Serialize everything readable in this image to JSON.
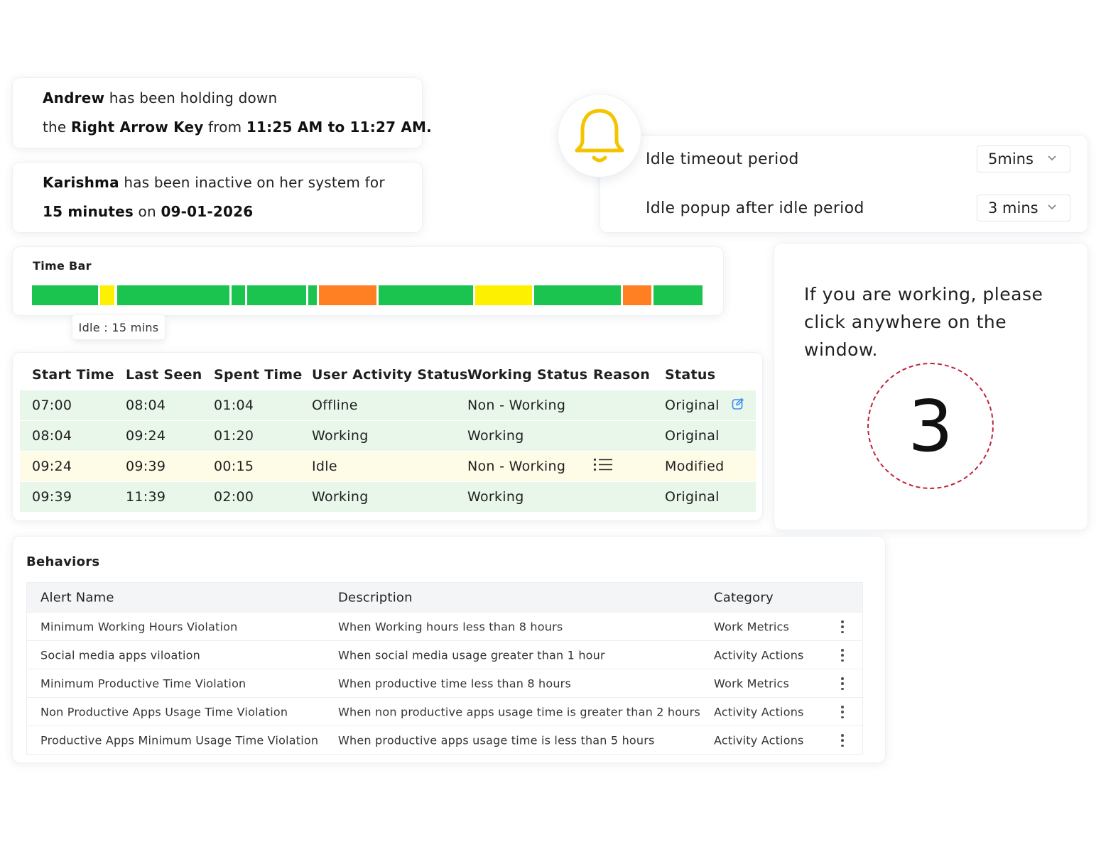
{
  "notifications": {
    "andrew": {
      "name": "Andrew",
      "text1": " has been holding down",
      "text2": "the ",
      "key": "Right Arrow Key",
      "text3": " from ",
      "time_range": "11:25 AM to 11:27 AM."
    },
    "karishma": {
      "name": "Karishma",
      "text1": " has been inactive on her system for",
      "duration": "15 minutes",
      "text2": " on ",
      "date": "09-01-2026"
    }
  },
  "idle_settings": {
    "icon": "bell-icon",
    "bell_color": "#f5c400",
    "timeout_label": "Idle timeout period",
    "timeout_value": "5mins",
    "popup_label": "Idle popup after idle period",
    "popup_value": "3 mins"
  },
  "time_bar": {
    "title": "Time Bar",
    "tooltip": "Idle : 15 mins",
    "colors": {
      "working": "#1ac44e",
      "idle": "#fdf000",
      "offline": "#ff8022"
    },
    "segments": [
      {
        "status": "working",
        "share": 9.4
      },
      {
        "status": "idle",
        "share": 2.1
      },
      {
        "status": "working",
        "share": 16.1
      },
      {
        "status": "working",
        "share": 1.9
      },
      {
        "status": "working",
        "share": 8.4
      },
      {
        "status": "working",
        "share": 1.2
      },
      {
        "status": "offline",
        "share": 8.2
      },
      {
        "status": "working",
        "share": 13.5
      },
      {
        "status": "idle",
        "share": 8.1
      },
      {
        "status": "working",
        "share": 12.4
      },
      {
        "status": "offline",
        "share": 4.0
      },
      {
        "status": "working",
        "share": 7.0
      }
    ]
  },
  "activity_table": {
    "headers": [
      "Start Time",
      "Last Seen",
      "Spent Time",
      "User Activity Status",
      "Working Status",
      "Reason",
      "Status"
    ],
    "rows": [
      {
        "start": "07:00",
        "last": "08:04",
        "spent": "01:04",
        "activity": "Offline",
        "working": "Non - Working",
        "reason_icon": "",
        "status": "Original",
        "edit_icon": "edit-icon"
      },
      {
        "start": "08:04",
        "last": "09:24",
        "spent": "01:20",
        "activity": "Working",
        "working": "Working",
        "reason_icon": "",
        "status": "Original",
        "edit_icon": ""
      },
      {
        "start": "09:24",
        "last": "09:39",
        "spent": "00:15",
        "activity": "Idle",
        "working": "Non - Working",
        "reason_icon": "list-icon",
        "status": "Modified",
        "edit_icon": ""
      },
      {
        "start": "09:39",
        "last": "11:39",
        "spent": "02:00",
        "activity": "Working",
        "working": "Working",
        "reason_icon": "",
        "status": "Original",
        "edit_icon": ""
      }
    ]
  },
  "countdown": {
    "message": "If you are working, please click anywhere on the window.",
    "number": "3",
    "ring_color": "#c0223c"
  },
  "behaviors": {
    "title": "Behaviors",
    "headers": [
      "Alert Name",
      "Description",
      "Category"
    ],
    "rows": [
      {
        "name": "Minimum Working Hours Violation",
        "description": "When Working hours less than 8 hours",
        "category": "Work Metrics"
      },
      {
        "name": "Social media apps viloation",
        "description": "When social media usage greater than 1 hour",
        "category": "Activity Actions"
      },
      {
        "name": "Minimum Productive Time Violation",
        "description": "When productive time less than 8 hours",
        "category": "Work Metrics"
      },
      {
        "name": "Non Productive Apps Usage Time Violation",
        "description": "When non productive apps usage time is greater than 2 hours",
        "category": "Activity Actions"
      },
      {
        "name": "Productive Apps Minimum Usage Time Violation",
        "description": "When productive apps usage time is less than 5 hours",
        "category": "Activity Actions"
      }
    ]
  }
}
